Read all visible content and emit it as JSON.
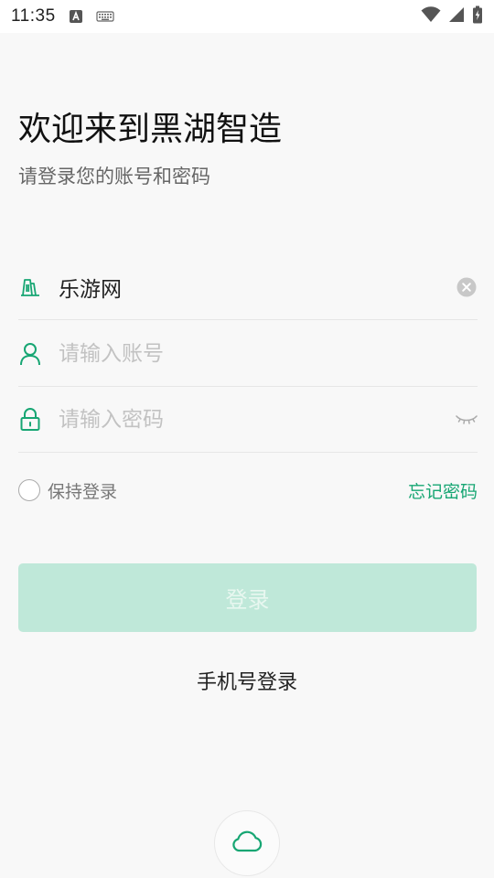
{
  "status_bar": {
    "time": "11:35"
  },
  "header": {
    "welcome_prefix": "欢迎来到",
    "brand": "黑湖智造",
    "subtitle": "请登录您的账号和密码"
  },
  "form": {
    "factory": {
      "value": "乐游网",
      "icon": "factory-icon",
      "clear_icon": "clear-icon"
    },
    "account": {
      "value": "",
      "placeholder": "请输入账号",
      "icon": "user-icon"
    },
    "password": {
      "value": "",
      "placeholder": "请输入密码",
      "icon": "lock-icon",
      "toggle_icon": "eye-closed-icon"
    },
    "keep_login_label": "保持登录",
    "forgot_password_label": "忘记密码"
  },
  "login_button_label": "登录",
  "phone_login_label": "手机号登录",
  "cloud_icon": "cloud-icon",
  "colors": {
    "accent": "#17a673",
    "button_disabled_bg": "#bfe8d9",
    "background": "#f8f8f8"
  }
}
